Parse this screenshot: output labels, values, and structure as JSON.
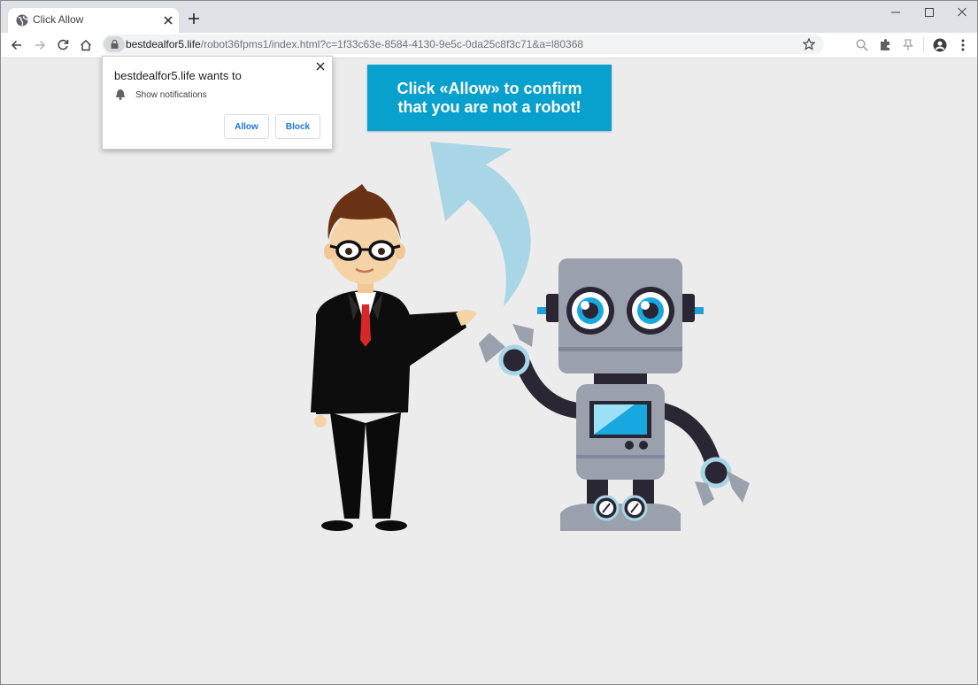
{
  "tab": {
    "title": "Click Allow"
  },
  "address_bar": {
    "host": "bestdealfor5.life",
    "path": "/robot36fpms1/index.html?c=1f33c63e-8584-4130-9e5c-0da25c8f3c71&a=l80368"
  },
  "permission_popup": {
    "origin_text": "bestdealfor5.life wants to",
    "permission": "Show notifications",
    "allow_label": "Allow",
    "block_label": "Block"
  },
  "page": {
    "banner_line1": "Click «Allow» to confirm",
    "banner_line2": "that you are not a robot!"
  },
  "icons": {
    "tab": [
      "globe-icon",
      "close-icon",
      "plus-icon"
    ],
    "window": [
      "minimize-icon",
      "maximize-icon",
      "close-window-icon"
    ],
    "toolbar": [
      "back-arrow-icon",
      "forward-arrow-icon",
      "reload-icon",
      "home-icon",
      "lock-icon",
      "star-icon",
      "zoom-icon",
      "extension-icon",
      "pin-icon",
      "profile-icon",
      "menu-dots-icon"
    ],
    "popup": [
      "bell-icon",
      "close-icon"
    ]
  },
  "colors": {
    "banner": "#08a0cd",
    "page_background": "#ececec",
    "arrow": "#a9d6e6",
    "button_text": "#1a73e8"
  }
}
